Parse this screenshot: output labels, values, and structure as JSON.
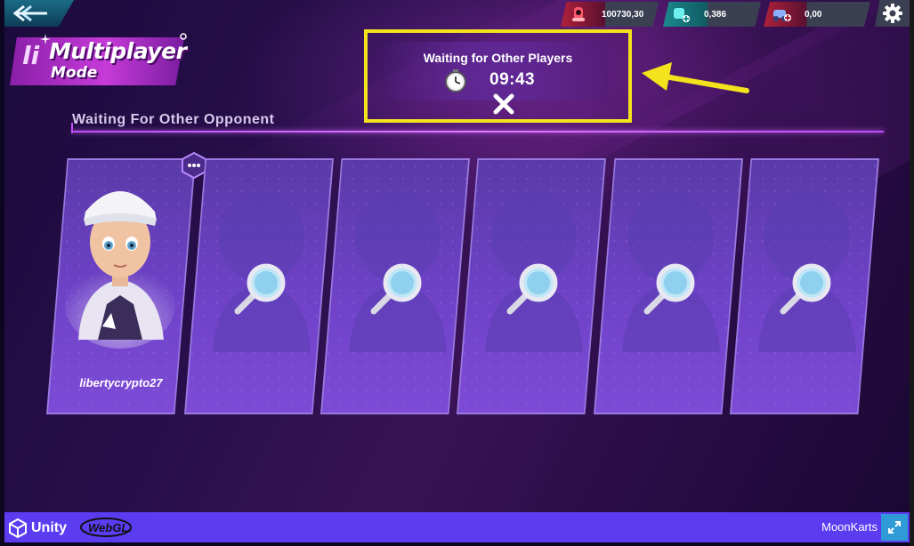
{
  "header": {
    "mode_title_line1": "Multiplayer",
    "mode_title_line2": "Mode",
    "currencies": [
      {
        "icon": "red-kart-icon",
        "value": "100730,30",
        "color": "#b0213a"
      },
      {
        "icon": "teal-token-icon",
        "value": "0,386",
        "color": "#1a8a8e"
      },
      {
        "icon": "blue-kart-icon",
        "value": "0,00",
        "color": "#b0213a"
      }
    ]
  },
  "waiting": {
    "title": "Waiting for Other Players",
    "timer": "09:43"
  },
  "section": {
    "heading": "Waiting For Other Opponent"
  },
  "players": [
    {
      "name": "libertycrypto27",
      "state": "joined"
    },
    {
      "name": "",
      "state": "searching"
    },
    {
      "name": "",
      "state": "searching"
    },
    {
      "name": "",
      "state": "searching"
    },
    {
      "name": "",
      "state": "searching"
    },
    {
      "name": "",
      "state": "searching"
    }
  ],
  "footer": {
    "engine": "Unity",
    "renderer": "WebGL.",
    "game_name": "MoonKarts"
  },
  "colors": {
    "highlight_box": "#f3e21c",
    "unity_bar": "#5b3cf0",
    "card": "#6f42c8",
    "accent": "#c04cff"
  }
}
